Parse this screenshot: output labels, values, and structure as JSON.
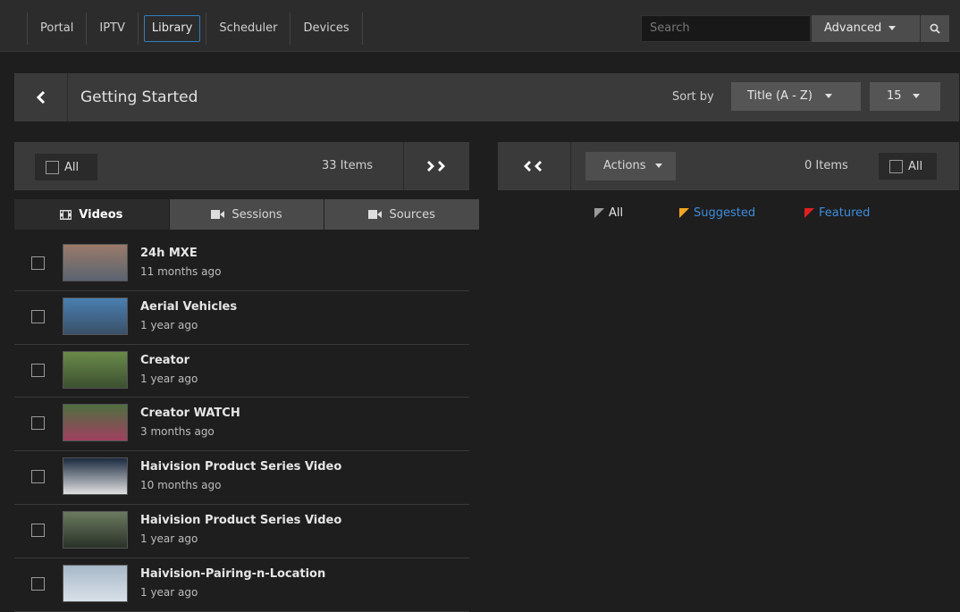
{
  "nav": {
    "tabs": [
      {
        "label": "Portal"
      },
      {
        "label": "IPTV"
      },
      {
        "label": "Library"
      },
      {
        "label": "Scheduler"
      },
      {
        "label": "Devices"
      }
    ],
    "active_tab": "Library",
    "search_placeholder": "Search",
    "advanced_label": "Advanced"
  },
  "header": {
    "title": "Getting Started",
    "sort_label": "Sort by",
    "sort_value": "Title (A - Z)",
    "page_size": "15"
  },
  "left": {
    "all_label": "All",
    "items_count": "33 Items",
    "tabs": {
      "videos": "Videos",
      "sessions": "Sessions",
      "sources": "Sources"
    },
    "videos": [
      {
        "title": "24h MXE",
        "date": "11 months ago",
        "thumb": [
          "#9a7a6a",
          "#5a6470"
        ]
      },
      {
        "title": "Aerial Vehicles",
        "date": "1 year ago",
        "thumb": [
          "#4a7fb0",
          "#3a5068"
        ]
      },
      {
        "title": "Creator",
        "date": "1 year ago",
        "thumb": [
          "#6a8a4a",
          "#3c5030"
        ]
      },
      {
        "title": "Creator WATCH",
        "date": "3 months ago",
        "thumb": [
          "#4f7040",
          "#a04060"
        ]
      },
      {
        "title": "Haivision Product Series Video",
        "date": "10 months ago",
        "thumb": [
          "#1a2a40",
          "#e0e0e0"
        ]
      },
      {
        "title": "Haivision Product Series Video",
        "date": "1 year ago",
        "thumb": [
          "#6a7a60",
          "#2a3228"
        ]
      },
      {
        "title": "Haivision-Pairing-n-Location",
        "date": "1 year ago",
        "thumb": [
          "#a8b8c8",
          "#d8e0e8"
        ]
      }
    ]
  },
  "right": {
    "actions_label": "Actions",
    "items_count": "0 Items",
    "all_label": "All",
    "filters": [
      {
        "label": "All",
        "color": "#9a9a9a",
        "text_color": "#e6e6e6"
      },
      {
        "label": "Suggested",
        "color": "#f5a623",
        "text_color": "#3d8ddc"
      },
      {
        "label": "Featured",
        "color": "#e02020",
        "text_color": "#3d8ddc"
      }
    ]
  }
}
